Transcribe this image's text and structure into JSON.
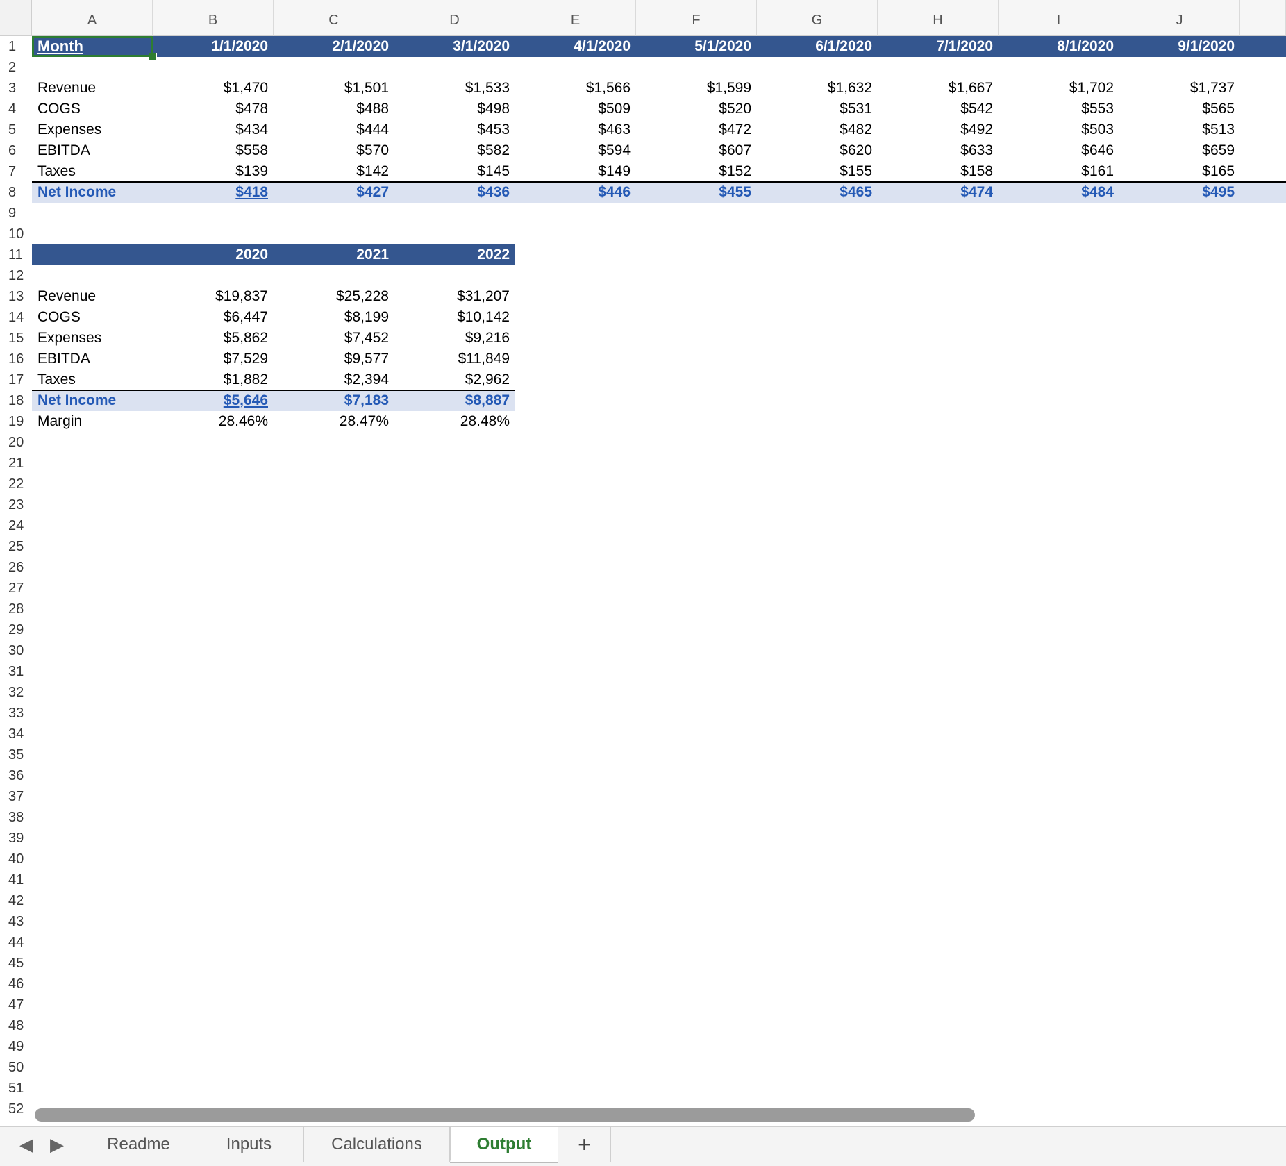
{
  "columns": [
    "A",
    "B",
    "C",
    "D",
    "E",
    "F",
    "G",
    "H",
    "I",
    "J"
  ],
  "header_row": {
    "label": "Month",
    "dates": [
      "1/1/2020",
      "2/1/2020",
      "3/1/2020",
      "4/1/2020",
      "5/1/2020",
      "6/1/2020",
      "7/1/2020",
      "8/1/2020",
      "9/1/2020"
    ]
  },
  "monthly": {
    "rows": [
      {
        "label": "Revenue",
        "values": [
          "$1,470",
          "$1,501",
          "$1,533",
          "$1,566",
          "$1,599",
          "$1,632",
          "$1,667",
          "$1,702",
          "$1,737"
        ]
      },
      {
        "label": "COGS",
        "values": [
          "$478",
          "$488",
          "$498",
          "$509",
          "$520",
          "$531",
          "$542",
          "$553",
          "$565"
        ]
      },
      {
        "label": "Expenses",
        "values": [
          "$434",
          "$444",
          "$453",
          "$463",
          "$472",
          "$482",
          "$492",
          "$503",
          "$513"
        ]
      },
      {
        "label": "EBITDA",
        "values": [
          "$558",
          "$570",
          "$582",
          "$594",
          "$607",
          "$620",
          "$633",
          "$646",
          "$659"
        ]
      },
      {
        "label": "Taxes",
        "values": [
          "$139",
          "$142",
          "$145",
          "$149",
          "$152",
          "$155",
          "$158",
          "$161",
          "$165"
        ]
      }
    ],
    "net_income": {
      "label": "Net Income",
      "values": [
        "$418",
        "$427",
        "$436",
        "$446",
        "$455",
        "$465",
        "$474",
        "$484",
        "$495"
      ]
    }
  },
  "annual": {
    "years": [
      "2020",
      "2021",
      "2022"
    ],
    "rows": [
      {
        "label": "Revenue",
        "values": [
          "$19,837",
          "$25,228",
          "$31,207"
        ]
      },
      {
        "label": "COGS",
        "values": [
          "$6,447",
          "$8,199",
          "$10,142"
        ]
      },
      {
        "label": "Expenses",
        "values": [
          "$5,862",
          "$7,452",
          "$9,216"
        ]
      },
      {
        "label": "EBITDA",
        "values": [
          "$7,529",
          "$9,577",
          "$11,849"
        ]
      },
      {
        "label": "Taxes",
        "values": [
          "$1,882",
          "$2,394",
          "$2,962"
        ]
      }
    ],
    "net_income": {
      "label": "Net Income",
      "values": [
        "$5,646",
        "$7,183",
        "$8,887"
      ]
    },
    "margin": {
      "label": "Margin",
      "values": [
        "28.46%",
        "28.47%",
        "28.48%"
      ]
    }
  },
  "row_numbers": [
    "1",
    "2",
    "3",
    "4",
    "5",
    "6",
    "7",
    "8",
    "9",
    "10",
    "11",
    "12",
    "13",
    "14",
    "15",
    "16",
    "17",
    "18",
    "19",
    "20",
    "21",
    "22",
    "23",
    "24",
    "25",
    "26",
    "27",
    "28",
    "29",
    "30",
    "31",
    "32",
    "33",
    "34",
    "35",
    "36",
    "37",
    "38",
    "39",
    "40",
    "41",
    "42",
    "43",
    "44",
    "45",
    "46",
    "47",
    "48",
    "49",
    "50",
    "51",
    "52"
  ],
  "tabs": [
    "Readme",
    "Inputs",
    "Calculations",
    "Output"
  ],
  "active_tab": "Output",
  "add_sheet_icon": "+",
  "colors": {
    "header_bar": "#34568f",
    "net_income_fill": "#dbe2f1",
    "net_income_text": "#2459b5",
    "active_tab": "#2e7d32"
  }
}
